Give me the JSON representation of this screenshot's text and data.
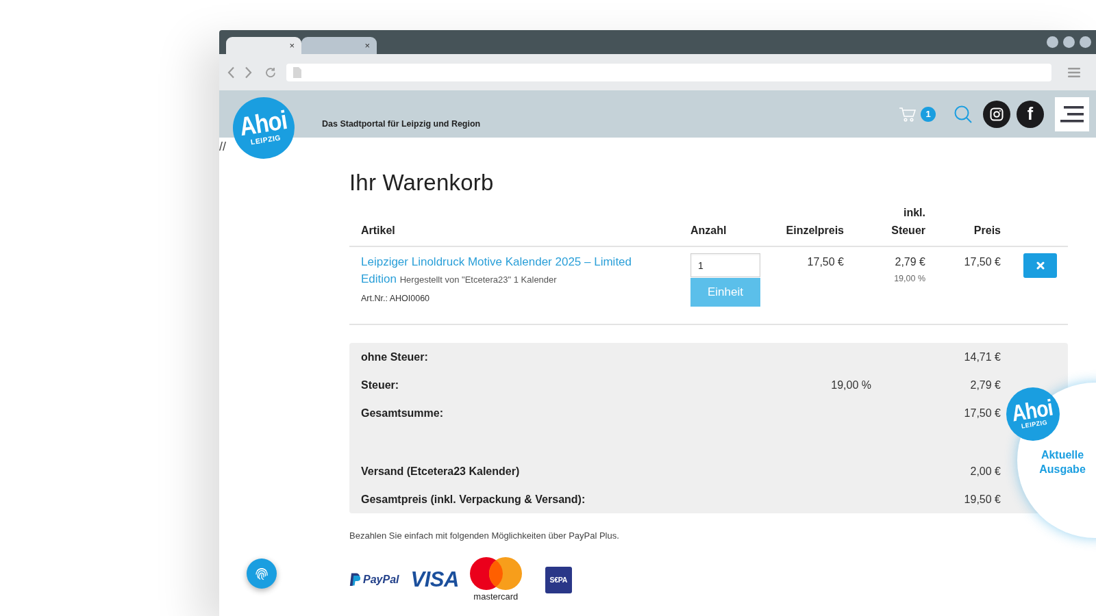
{
  "browser": {
    "tabs": [
      {
        "close": "×",
        "selected": true
      },
      {
        "close": "×",
        "selected": false
      }
    ]
  },
  "header": {
    "logo": {
      "title": "Ahoi",
      "subtitle": "LEIPZIG"
    },
    "tagline": "Das Stadtportal für Leipzig und Region",
    "cart_count": "1",
    "social": [
      {
        "kind": "instagram"
      },
      {
        "kind": "facebook",
        "glyph": "f"
      }
    ]
  },
  "page_marker": "//",
  "title": "Ihr Warenkorb",
  "cart": {
    "columns": [
      "Artikel",
      "Anzahl",
      "Einzelpreis",
      "inkl. Steuer",
      "Preis"
    ],
    "items": [
      {
        "name": "Leipziger Linoldruck Motive Kalender 2025 – Limited Edition",
        "note": "Hergestellt von \"Etcetera23\" 1 Kalender",
        "article_number": "Art.Nr.: AHOI0060",
        "quantity": "1",
        "unit_button": "Einheit",
        "unit_price": "17,50 €",
        "tax": "2,79 €",
        "tax_rate": "19,00 %",
        "price": "17,50 €"
      }
    ]
  },
  "totals": {
    "summary": [
      {
        "label": "ohne Steuer:",
        "value": "14,71 €"
      },
      {
        "label": "Steuer:",
        "rate": "19,00 %",
        "value": "2,79 €"
      },
      {
        "label": "Gesamtsumme:",
        "value": "17,50 €"
      }
    ],
    "shipping": [
      {
        "label": "Versand (Etcetera23 Kalender)",
        "value": "2,00 €"
      },
      {
        "label": "Gesamtpreis (inkl. Verpackung & Versand):",
        "value": "19,50 €"
      }
    ]
  },
  "payment": {
    "text": "Bezahlen Sie einfach mit folgenden Möglichkeiten über PayPal Plus.",
    "methods": [
      {
        "kind": "paypal",
        "label": "PayPal"
      },
      {
        "kind": "visa",
        "label": "VISA"
      },
      {
        "kind": "mastercard",
        "label": "mastercard"
      },
      {
        "kind": "sepa",
        "label": "S€PA"
      }
    ]
  },
  "teaser": {
    "logo": {
      "title": "Ahoi",
      "subtitle": "LEIPZIG"
    },
    "label": "Aktuelle Ausgabe"
  }
}
